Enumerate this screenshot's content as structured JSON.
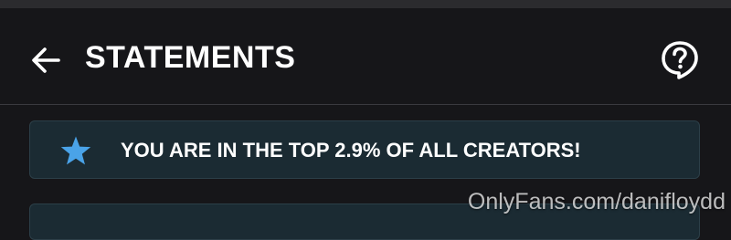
{
  "header": {
    "title": "STATEMENTS",
    "back_icon": "arrow-left-icon",
    "help_icon": "question-bubble-icon"
  },
  "banner": {
    "icon": "star-icon",
    "icon_color": "#4aa3e8",
    "text": "YOU ARE IN THE TOP 2.9% OF ALL CREATORS!"
  },
  "watermark": {
    "text": "OnlyFans.com/danifloydd"
  },
  "colors": {
    "background": "#161619",
    "banner_bg": "#1b2b33",
    "banner_border": "#2c3f48",
    "divider": "#3a3a3f",
    "text": "#ffffff"
  }
}
